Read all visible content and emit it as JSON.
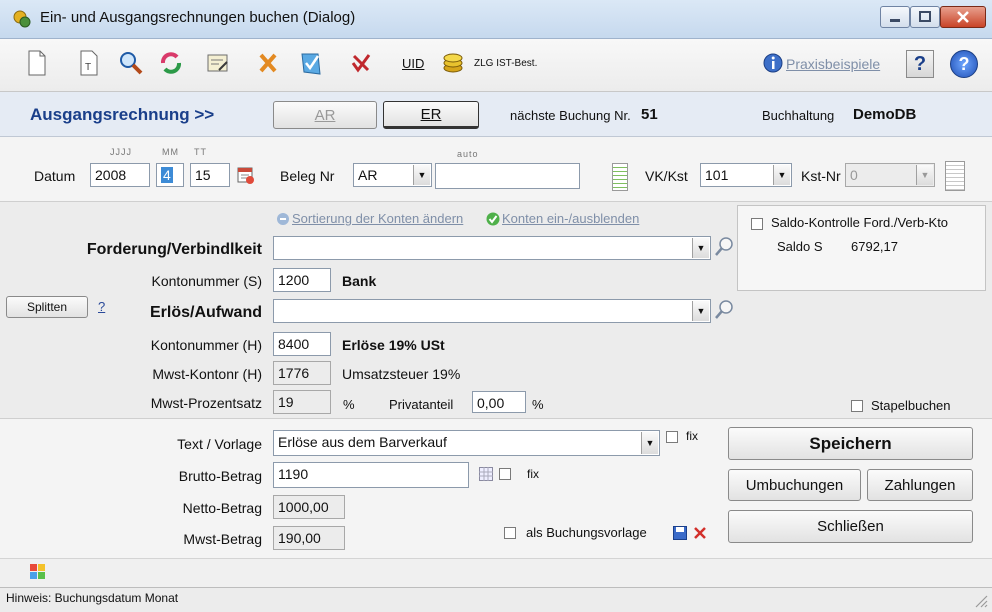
{
  "window": {
    "title": "Ein- und Ausgangsrechnungen buchen (Dialog)"
  },
  "toolbar": {
    "uid_label": "UID",
    "zlg_label": "ZLG IST-Best.",
    "praxis_label": "Praxisbeispiele",
    "help_q": "?",
    "info_q": "?"
  },
  "header": {
    "mode_label": "Ausgangsrechnung >>",
    "tab_ar": "AR",
    "tab_er": "ER",
    "next_label": "nächste Buchung Nr.",
    "next_value": "51",
    "bh_label": "Buchhaltung",
    "bh_value": "DemoDB"
  },
  "datum": {
    "label": "Datum",
    "hint_year": "JJJJ",
    "hint_month": "MM",
    "hint_day": "TT",
    "year": "2008",
    "month": "4",
    "day": "15",
    "beleg_label": "Beleg Nr",
    "beleg_type": "AR",
    "beleg_hint": "auto",
    "beleg_value": "",
    "vk_label": "VK/Kst",
    "vk_value": "101",
    "kst_label": "Kst-Nr",
    "kst_value": "0"
  },
  "konten": {
    "sort_link": "Sortierung der Konten ändern",
    "toggle_link": "Konten ein-/ausblenden",
    "saldo_check_label": "Saldo-Kontrolle Ford./Verb-Kto",
    "saldo_label": "Saldo S",
    "saldo_value": "6792,17",
    "forderung_label": "Forderung/Verbindlkeit",
    "forderung_value": "",
    "kontonr_s_label": "Kontonummer (S)",
    "kontonr_s_value": "1200",
    "kontonr_s_name": "Bank",
    "splitten_label": "Splitten",
    "splitten_help": "?",
    "erloes_label": "Erlös/Aufwand",
    "erloes_value": "",
    "kontonr_h_label": "Kontonummer (H)",
    "kontonr_h_value": "8400",
    "kontonr_h_name": "Erlöse 19% USt",
    "mwst_kto_label": "Mwst-Kontonr (H)",
    "mwst_kto_value": "1776",
    "mwst_kto_name": "Umsatzsteuer 19%",
    "mwst_satz_label": "Mwst-Prozentsatz",
    "mwst_satz_value": "19",
    "percent_sign": "%",
    "privat_label": "Privatanteil",
    "privat_value": "0,00",
    "privat_percent": "%",
    "stapel_label": "Stapelbuchen"
  },
  "betrag": {
    "text_label": "Text / Vorlage",
    "text_value": "Erlöse aus dem Barverkauf",
    "fix_label": "fix",
    "brutto_label": "Brutto-Betrag",
    "brutto_value": "1190",
    "brutto_fix_label": "fix",
    "netto_label": "Netto-Betrag",
    "netto_value": "1000,00",
    "mwst_label": "Mwst-Betrag",
    "mwst_value": "190,00",
    "vorlage_label": "als Buchungsvorlage"
  },
  "buttons": {
    "speichern": "Speichern",
    "umbuchungen": "Umbuchungen",
    "zahlungen": "Zahlungen",
    "schliessen": "Schließen"
  },
  "status": {
    "hint": "Hinweis: Buchungsdatum Monat"
  },
  "colors": {
    "accent_blue": "#1a3f8a",
    "er_border": "#c0282d",
    "title_grad": "#c6d9ee"
  }
}
